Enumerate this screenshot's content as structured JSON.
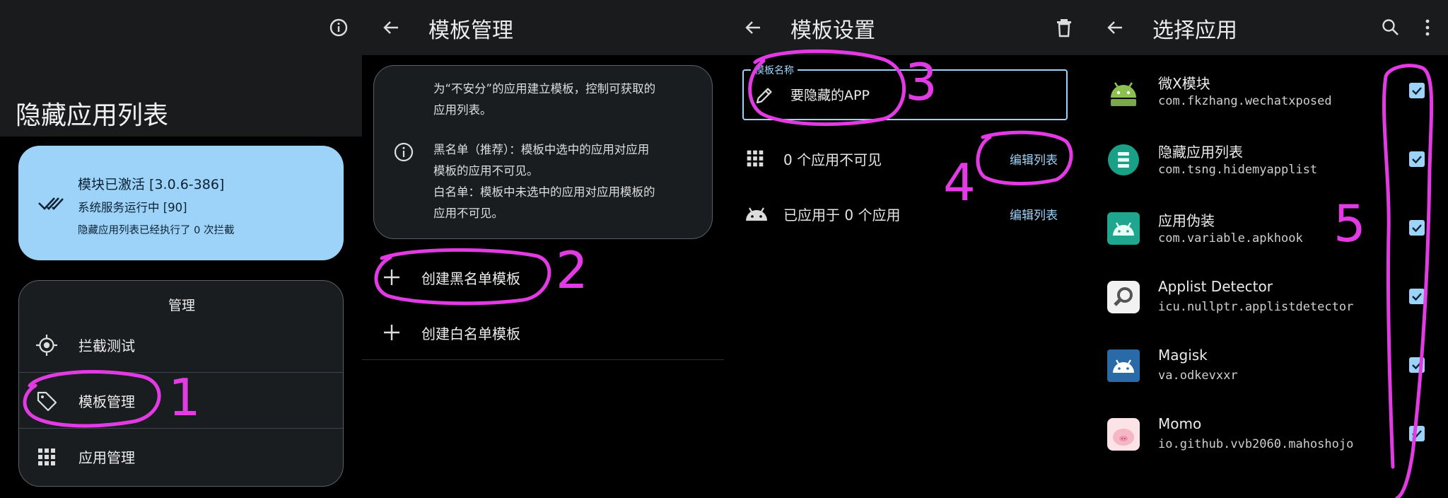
{
  "colors": {
    "accent": "#9dd3f9",
    "annotation": "#e23be3",
    "status_card": "#9dd3f9",
    "card_bg": "#1a1d20"
  },
  "panel1": {
    "title": "隐藏应用列表",
    "status": {
      "title": "模块已激活 [3.0.6-386]",
      "service": "系统服务运行中 [90]",
      "intercept": "隐藏应用列表已经执行了 0 次拦截"
    },
    "manage": {
      "title": "管理",
      "items": [
        {
          "label": "拦截测试",
          "icon": "target-icon"
        },
        {
          "label": "模板管理",
          "icon": "tag-icon"
        },
        {
          "label": "应用管理",
          "icon": "grid-icon"
        }
      ]
    }
  },
  "panel2": {
    "title": "模板管理",
    "info": {
      "line1": "为“不安分”的应用建立模板，控制可获取的",
      "line2": "应用列表。",
      "line3": "黑名单（推荐）：模板中选中的应用对应用",
      "line4": "模板的应用不可见。",
      "line5": "白名单：模板中未选中的应用对应用模板的",
      "line6": "应用不可见。"
    },
    "create_blacklist": "创建黑名单模板",
    "create_whitelist": "创建白名单模板"
  },
  "panel3": {
    "title": "模板设置",
    "field_label": "模板名称",
    "field_value": "要隐藏的APP",
    "invisible_count": "0 个应用不可见",
    "applied_count": "已应用于 0 个应用",
    "edit_list": "编辑列表",
    "edit_list_2": "编辑列表"
  },
  "panel4": {
    "title": "选择应用",
    "apps": [
      {
        "name": "微X模块",
        "pkg": "com.fkzhang.wechatxposed",
        "icon": "android-icon",
        "checked": true
      },
      {
        "name": "隐藏应用列表",
        "pkg": "com.tsng.hidemyapplist",
        "icon": "list-icon",
        "checked": true
      },
      {
        "name": "应用伪装",
        "pkg": "com.variable.apkhook",
        "icon": "android-icon",
        "checked": true
      },
      {
        "name": "Applist Detector",
        "pkg": "icu.nullptr.applistdetector",
        "icon": "magnifier-icon",
        "checked": true
      },
      {
        "name": "Magisk",
        "pkg": "va.odkevxxr",
        "icon": "android-icon",
        "checked": true
      },
      {
        "name": "Momo",
        "pkg": "io.github.vvb2060.mahoshojo",
        "icon": "pig-icon",
        "checked": true
      }
    ]
  },
  "annotations": [
    "1",
    "2",
    "3",
    "4",
    "5"
  ]
}
